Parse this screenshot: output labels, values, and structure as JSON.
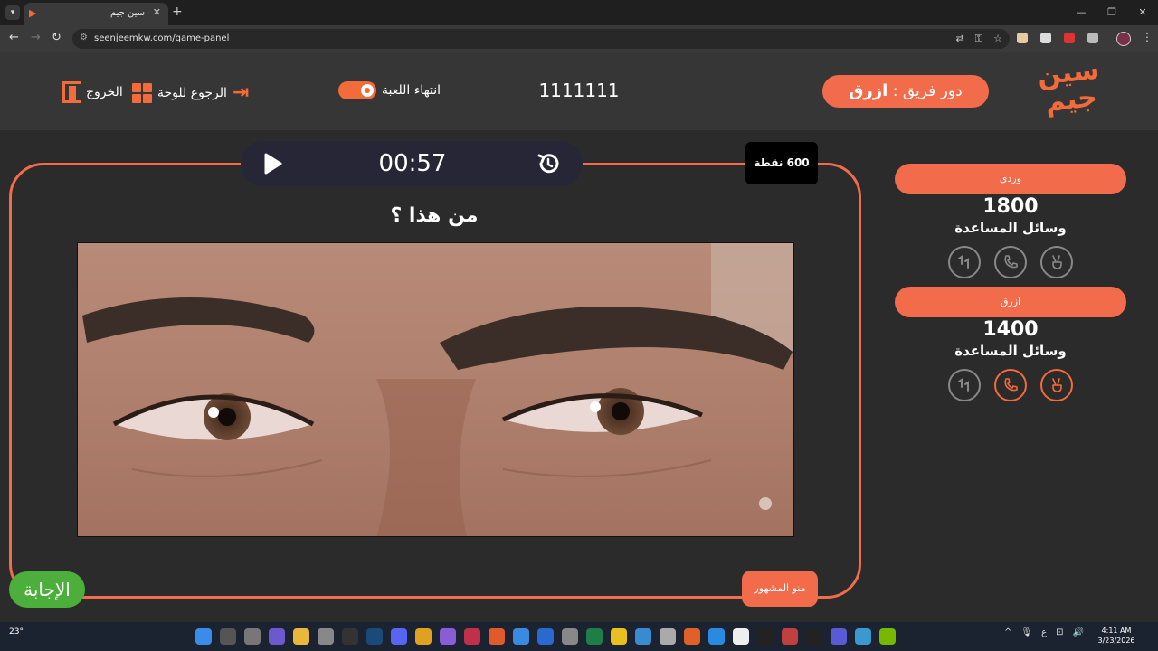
{
  "browser": {
    "tab_title": "سين جيم",
    "url": "seenjeemkw.com/game-panel"
  },
  "header": {
    "logo_text": "سين جيم",
    "turn_label": "دور فريق :",
    "turn_team": "ازرق",
    "game_code": "1111111",
    "end_game_label": "انتهاء اللعبة",
    "back_to_board_label": "الرجوع للوحة",
    "exit_label": "الخروج"
  },
  "question": {
    "timer": "00:57",
    "points": "600 نقطة",
    "title": "من هذا ؟",
    "category": "منو المشهور",
    "answer_label": "الإجابة"
  },
  "teams": [
    {
      "name": "وردي",
      "score": "1800",
      "aids_label": "وسائل المساعدة",
      "aids": [
        "two-answers",
        "call-friend",
        "hole"
      ],
      "active_aids": []
    },
    {
      "name": "ازرق",
      "score": "1400",
      "aids_label": "وسائل المساعدة",
      "aids": [
        "two-answers",
        "call-friend",
        "hole"
      ],
      "active_aids": [
        "two-answers",
        "call-friend"
      ]
    }
  ],
  "taskbar": {
    "weather": "23°",
    "time": "4:11 AM",
    "date": "3/23/2026",
    "lang": "ع"
  },
  "colors": {
    "accent": "#f26b4a",
    "answer": "#4caf3c",
    "background": "#2b2b2b"
  }
}
